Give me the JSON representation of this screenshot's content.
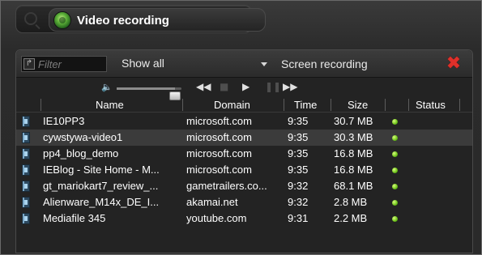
{
  "app": {
    "title": "Video recording",
    "logo_icon": "green-lens-icon"
  },
  "toolbar": {
    "filter_placeholder": "Filter",
    "show_select_value": "Show all",
    "screen_recording_label": "Screen recording",
    "close_icon": "red-x-icon",
    "close_color": "#e0302a"
  },
  "player": {
    "volume_icon": "speaker-icon",
    "volume_level": 0.9,
    "controls": [
      "rewind-icon",
      "stop-icon",
      "play-icon",
      "pause-icon",
      "fast-forward-icon"
    ]
  },
  "table": {
    "columns": [
      "Name",
      "Domain",
      "Time",
      "Size",
      "Status"
    ],
    "rows": [
      {
        "name": "IE10PP3",
        "domain": "microsoft.com",
        "time": "9:35",
        "size": "30.7 MB",
        "status": "green",
        "selected": false
      },
      {
        "name": "cywstywa-video1",
        "domain": "microsoft.com",
        "time": "9:35",
        "size": "30.3 MB",
        "status": "green",
        "selected": true
      },
      {
        "name": "pp4_blog_demo",
        "domain": "microsoft.com",
        "time": "9:35",
        "size": "16.8 MB",
        "status": "green",
        "selected": false
      },
      {
        "name": "IEBlog - Site Home - M...",
        "domain": "microsoft.com",
        "time": "9:35",
        "size": "16.8 MB",
        "status": "green",
        "selected": false
      },
      {
        "name": "gt_mariokart7_review_...",
        "domain": "gametrailers.co...",
        "time": "9:32",
        "size": "68.1 MB",
        "status": "green",
        "selected": false
      },
      {
        "name": "Alienware_M14x_DE_I...",
        "domain": "akamai.net",
        "time": "9:32",
        "size": "2.8 MB",
        "status": "green",
        "selected": false
      },
      {
        "name": "Mediafile 345",
        "domain": "youtube.com",
        "time": "9:31",
        "size": "2.2 MB",
        "status": "green",
        "selected": false
      }
    ]
  },
  "colors": {
    "status_green": "#6cc11a",
    "selected_row": "#3b3b3b"
  }
}
